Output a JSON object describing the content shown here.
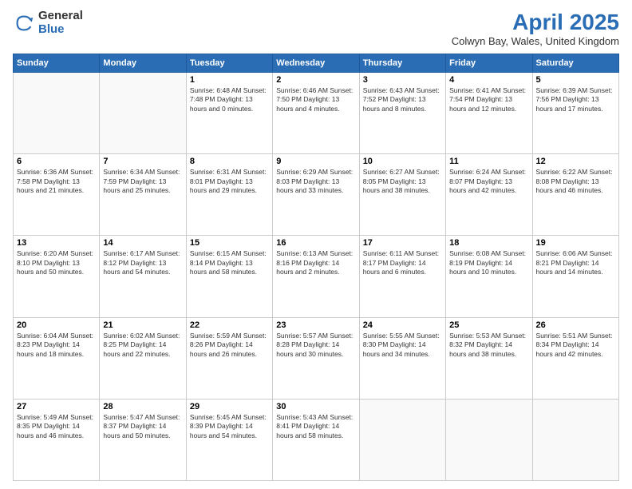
{
  "logo": {
    "general": "General",
    "blue": "Blue"
  },
  "header": {
    "title": "April 2025",
    "subtitle": "Colwyn Bay, Wales, United Kingdom"
  },
  "days_of_week": [
    "Sunday",
    "Monday",
    "Tuesday",
    "Wednesday",
    "Thursday",
    "Friday",
    "Saturday"
  ],
  "weeks": [
    [
      {
        "day": "",
        "info": ""
      },
      {
        "day": "",
        "info": ""
      },
      {
        "day": "1",
        "info": "Sunrise: 6:48 AM\nSunset: 7:48 PM\nDaylight: 13 hours\nand 0 minutes."
      },
      {
        "day": "2",
        "info": "Sunrise: 6:46 AM\nSunset: 7:50 PM\nDaylight: 13 hours\nand 4 minutes."
      },
      {
        "day": "3",
        "info": "Sunrise: 6:43 AM\nSunset: 7:52 PM\nDaylight: 13 hours\nand 8 minutes."
      },
      {
        "day": "4",
        "info": "Sunrise: 6:41 AM\nSunset: 7:54 PM\nDaylight: 13 hours\nand 12 minutes."
      },
      {
        "day": "5",
        "info": "Sunrise: 6:39 AM\nSunset: 7:56 PM\nDaylight: 13 hours\nand 17 minutes."
      }
    ],
    [
      {
        "day": "6",
        "info": "Sunrise: 6:36 AM\nSunset: 7:58 PM\nDaylight: 13 hours\nand 21 minutes."
      },
      {
        "day": "7",
        "info": "Sunrise: 6:34 AM\nSunset: 7:59 PM\nDaylight: 13 hours\nand 25 minutes."
      },
      {
        "day": "8",
        "info": "Sunrise: 6:31 AM\nSunset: 8:01 PM\nDaylight: 13 hours\nand 29 minutes."
      },
      {
        "day": "9",
        "info": "Sunrise: 6:29 AM\nSunset: 8:03 PM\nDaylight: 13 hours\nand 33 minutes."
      },
      {
        "day": "10",
        "info": "Sunrise: 6:27 AM\nSunset: 8:05 PM\nDaylight: 13 hours\nand 38 minutes."
      },
      {
        "day": "11",
        "info": "Sunrise: 6:24 AM\nSunset: 8:07 PM\nDaylight: 13 hours\nand 42 minutes."
      },
      {
        "day": "12",
        "info": "Sunrise: 6:22 AM\nSunset: 8:08 PM\nDaylight: 13 hours\nand 46 minutes."
      }
    ],
    [
      {
        "day": "13",
        "info": "Sunrise: 6:20 AM\nSunset: 8:10 PM\nDaylight: 13 hours\nand 50 minutes."
      },
      {
        "day": "14",
        "info": "Sunrise: 6:17 AM\nSunset: 8:12 PM\nDaylight: 13 hours\nand 54 minutes."
      },
      {
        "day": "15",
        "info": "Sunrise: 6:15 AM\nSunset: 8:14 PM\nDaylight: 13 hours\nand 58 minutes."
      },
      {
        "day": "16",
        "info": "Sunrise: 6:13 AM\nSunset: 8:16 PM\nDaylight: 14 hours\nand 2 minutes."
      },
      {
        "day": "17",
        "info": "Sunrise: 6:11 AM\nSunset: 8:17 PM\nDaylight: 14 hours\nand 6 minutes."
      },
      {
        "day": "18",
        "info": "Sunrise: 6:08 AM\nSunset: 8:19 PM\nDaylight: 14 hours\nand 10 minutes."
      },
      {
        "day": "19",
        "info": "Sunrise: 6:06 AM\nSunset: 8:21 PM\nDaylight: 14 hours\nand 14 minutes."
      }
    ],
    [
      {
        "day": "20",
        "info": "Sunrise: 6:04 AM\nSunset: 8:23 PM\nDaylight: 14 hours\nand 18 minutes."
      },
      {
        "day": "21",
        "info": "Sunrise: 6:02 AM\nSunset: 8:25 PM\nDaylight: 14 hours\nand 22 minutes."
      },
      {
        "day": "22",
        "info": "Sunrise: 5:59 AM\nSunset: 8:26 PM\nDaylight: 14 hours\nand 26 minutes."
      },
      {
        "day": "23",
        "info": "Sunrise: 5:57 AM\nSunset: 8:28 PM\nDaylight: 14 hours\nand 30 minutes."
      },
      {
        "day": "24",
        "info": "Sunrise: 5:55 AM\nSunset: 8:30 PM\nDaylight: 14 hours\nand 34 minutes."
      },
      {
        "day": "25",
        "info": "Sunrise: 5:53 AM\nSunset: 8:32 PM\nDaylight: 14 hours\nand 38 minutes."
      },
      {
        "day": "26",
        "info": "Sunrise: 5:51 AM\nSunset: 8:34 PM\nDaylight: 14 hours\nand 42 minutes."
      }
    ],
    [
      {
        "day": "27",
        "info": "Sunrise: 5:49 AM\nSunset: 8:35 PM\nDaylight: 14 hours\nand 46 minutes."
      },
      {
        "day": "28",
        "info": "Sunrise: 5:47 AM\nSunset: 8:37 PM\nDaylight: 14 hours\nand 50 minutes."
      },
      {
        "day": "29",
        "info": "Sunrise: 5:45 AM\nSunset: 8:39 PM\nDaylight: 14 hours\nand 54 minutes."
      },
      {
        "day": "30",
        "info": "Sunrise: 5:43 AM\nSunset: 8:41 PM\nDaylight: 14 hours\nand 58 minutes."
      },
      {
        "day": "",
        "info": ""
      },
      {
        "day": "",
        "info": ""
      },
      {
        "day": "",
        "info": ""
      }
    ]
  ]
}
